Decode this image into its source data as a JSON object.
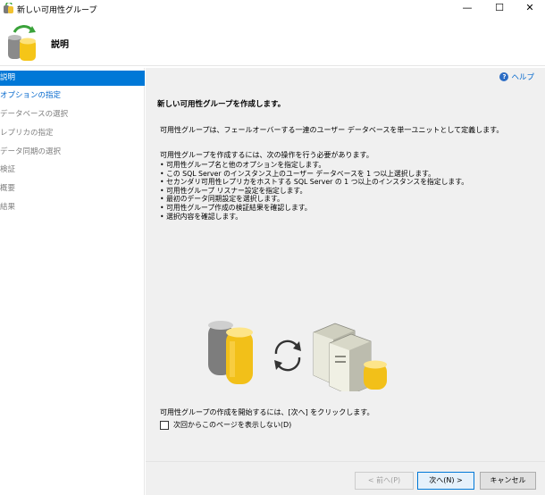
{
  "window": {
    "title": "新しい可用性グループ",
    "minimize": "—",
    "maximize": "☐",
    "close": "✕"
  },
  "header": {
    "title": "説明"
  },
  "sidebar": {
    "items": [
      {
        "label": "説明",
        "state": "active"
      },
      {
        "label": "オプションの指定",
        "state": "link"
      },
      {
        "label": "データベースの選択",
        "state": "disabled"
      },
      {
        "label": "レプリカの指定",
        "state": "disabled"
      },
      {
        "label": "データ同期の選択",
        "state": "disabled"
      },
      {
        "label": "検証",
        "state": "disabled"
      },
      {
        "label": "概要",
        "state": "disabled"
      },
      {
        "label": "結果",
        "state": "disabled"
      }
    ]
  },
  "main": {
    "help_label": "ヘルプ",
    "heading": "新しい可用性グループを作成します。",
    "intro": "可用性グループは、フェールオーバーする一連のユーザー データベースを単一ユニットとして定義します。",
    "steps_intro": "可用性グループを作成するには、次の操作を行う必要があります。",
    "steps": [
      "• 可用性グループ名と他のオプションを指定します。",
      "• この SQL Server のインスタンス上のユーザー データベースを 1 つ以上選択します。",
      "• セカンダリ可用性レプリカをホストする SQL Server の 1 つ以上のインスタンスを指定します。",
      "• 可用性グループ リスナー設定を指定します。",
      "• 最初のデータ同期設定を選択します。",
      "• 可用性グループ作成の検証結果を確認します。",
      "• 選択内容を確認します。"
    ],
    "footer_text": "可用性グループの作成を開始するには、[次へ] をクリックします。",
    "checkbox_label": "次回からこのページを表示しない(D)"
  },
  "buttons": {
    "back": "< 前へ(P)",
    "next": "次へ(N) >",
    "cancel": "キャンセル"
  }
}
